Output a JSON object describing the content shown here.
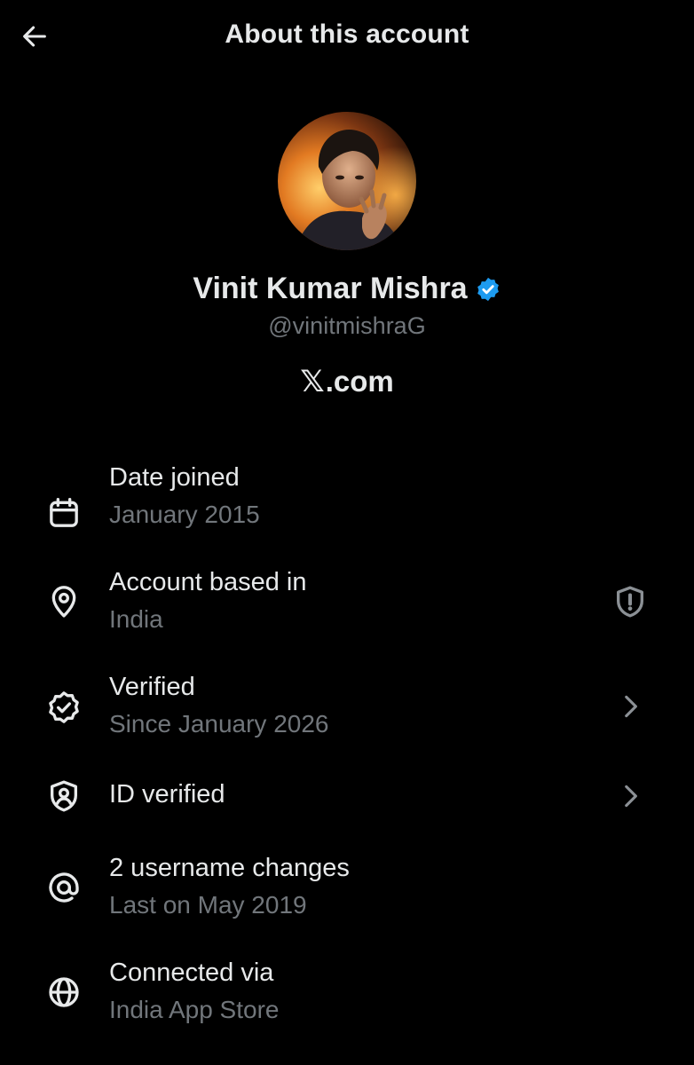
{
  "header": {
    "title": "About this account",
    "back_icon": "arrow-left-icon"
  },
  "profile": {
    "display_name": "Vinit Kumar Mishra",
    "handle": "@vinitmishraG",
    "verified_badge_color": "#1d9bf0",
    "site_glyph": "𝕏",
    "site_suffix": ".com"
  },
  "rows": [
    {
      "icon": "calendar-icon",
      "label": "Date joined",
      "sub": "January 2015",
      "trailing": null
    },
    {
      "icon": "location-pin-icon",
      "label": "Account based in",
      "sub": "India",
      "trailing": "shield-alert-icon"
    },
    {
      "icon": "verified-seal-icon",
      "label": "Verified",
      "sub": "Since January 2026",
      "trailing": "chevron-right-icon"
    },
    {
      "icon": "id-shield-icon",
      "label": "ID verified",
      "sub": null,
      "trailing": "chevron-right-icon"
    },
    {
      "icon": "at-sign-icon",
      "label": "2 username changes",
      "sub": "Last on May 2019",
      "trailing": null
    },
    {
      "icon": "globe-icon",
      "label": "Connected via",
      "sub": "India App Store",
      "trailing": null
    }
  ],
  "colors": {
    "background": "#000000",
    "primary_text": "#e7e9ea",
    "secondary_text": "#71767b",
    "accent": "#1d9bf0"
  }
}
